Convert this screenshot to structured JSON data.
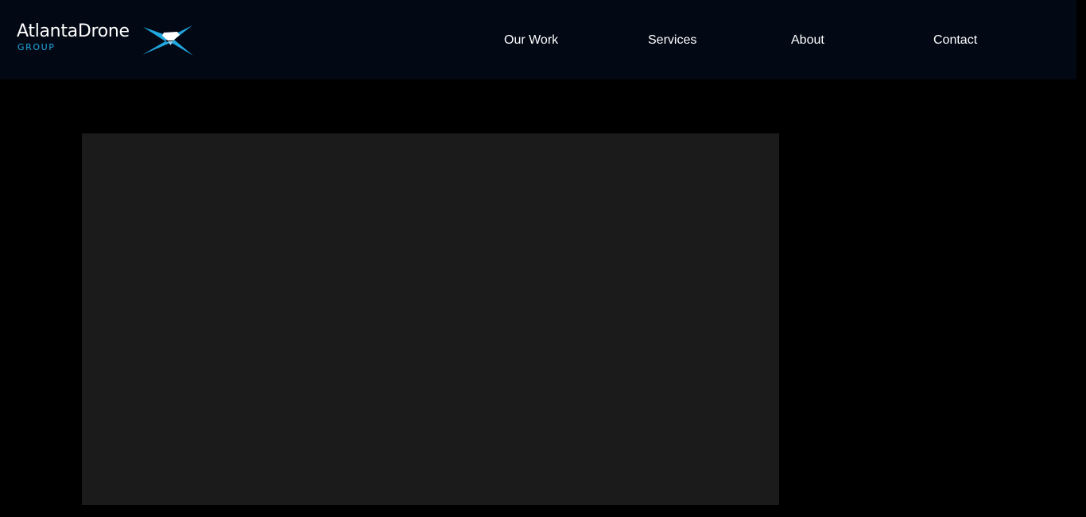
{
  "brand": {
    "name": "AtlantaDrone",
    "subtitle": "GROUP",
    "accent_color": "#21a8e0",
    "mark_icon": "drone-x-icon"
  },
  "nav": {
    "items": [
      {
        "label": "Our Work"
      },
      {
        "label": "Services"
      },
      {
        "label": "About"
      },
      {
        "label": "Contact"
      }
    ]
  },
  "colors": {
    "header_bg": "#020814",
    "page_bg": "#000000",
    "media_placeholder": "#1b1b1b"
  }
}
